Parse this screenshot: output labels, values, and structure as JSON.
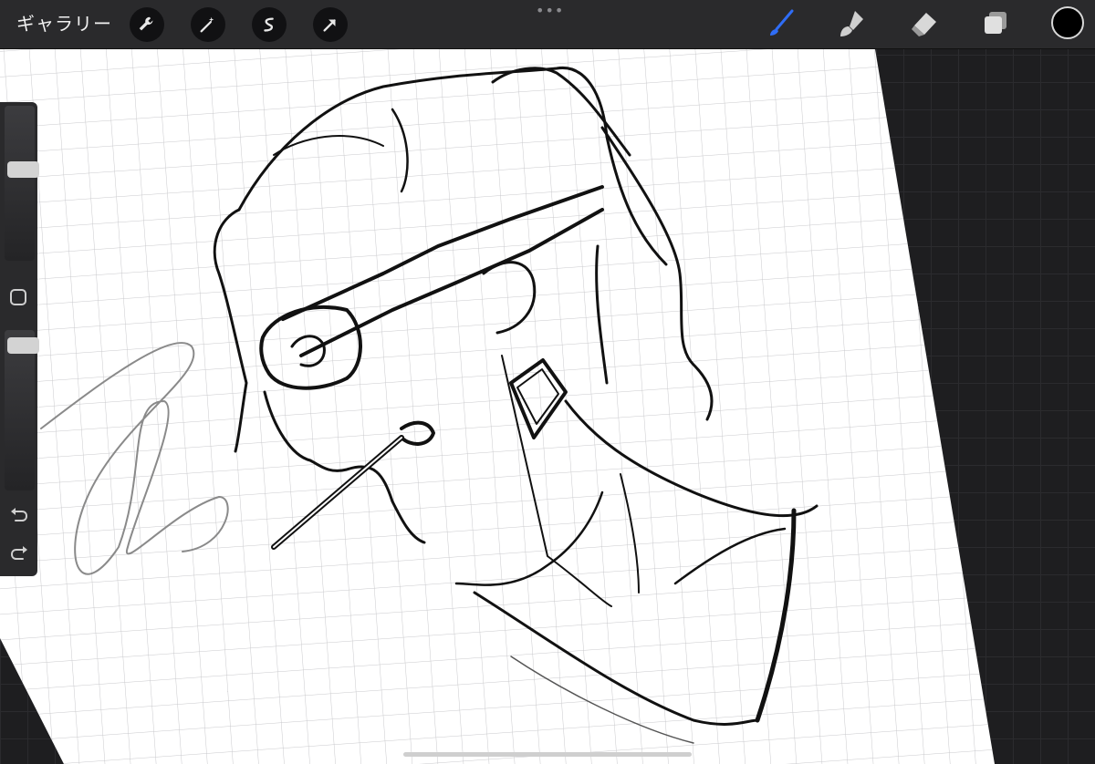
{
  "toolbar": {
    "gallery_label": "ギャラリー",
    "left_buttons": [
      "wrench-icon",
      "magic-wand-icon",
      "selection-icon",
      "transform-arrow-icon"
    ],
    "more_dots": "•••",
    "tools": [
      "brush-icon",
      "smudge-icon",
      "eraser-icon",
      "layers-icon"
    ],
    "active_tool": "brush",
    "accent_color": "#2f6df6",
    "current_color": "#000000"
  },
  "sidebar": {
    "brush_size_level": 0.6,
    "opacity_level": 0.95,
    "modify_button": "square-icon",
    "undo": "undo-icon",
    "redo": "redo-icon"
  },
  "colors": {
    "paper": "#ffffff",
    "paper_grid": "#c9c9cc",
    "workspace": "#1e1e20",
    "toolbar": "#2a2a2c",
    "ink": "#111111"
  }
}
